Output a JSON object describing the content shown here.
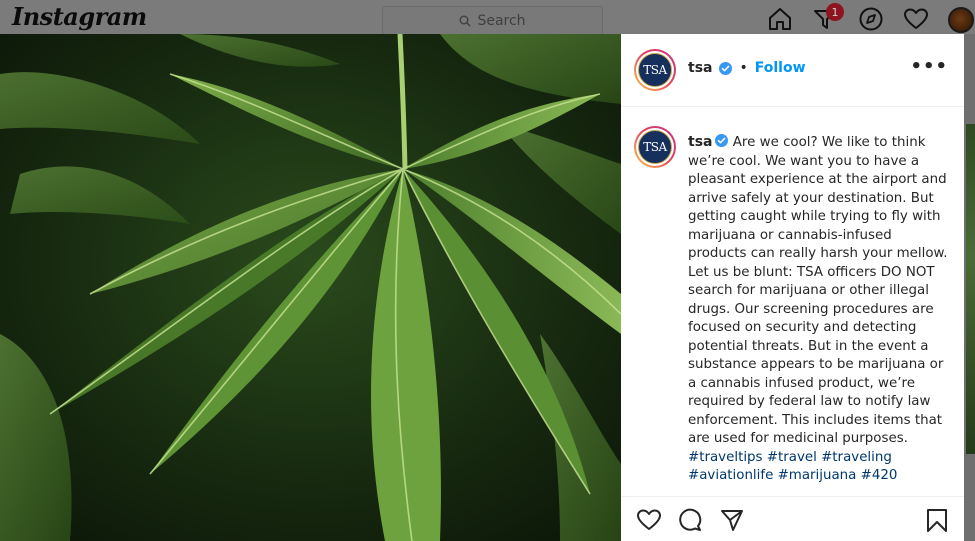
{
  "app": {
    "logo_text": "Instagram"
  },
  "search": {
    "placeholder": "Search",
    "icon": "search-icon"
  },
  "nav": {
    "icons": [
      "home-icon",
      "activity-icon",
      "explore-icon",
      "heart-icon",
      "profile-avatar"
    ],
    "activity_badge": "1"
  },
  "post": {
    "image": {
      "subject": "cannabis-leaf-photo"
    },
    "header": {
      "avatar_text": "TSA",
      "username": "tsa",
      "verified": true,
      "separator": "•",
      "follow_label": "Follow",
      "more_label": "•••"
    },
    "caption": {
      "username": "tsa",
      "lines": [
        "Are we cool? We like to think",
        "we’re cool. We want you to have a",
        "pleasant experience at the airport and",
        "arrive safely at your destination. But",
        "getting caught while trying to fly with",
        "marijuana or cannabis-infused",
        "products can really harsh your mellow.",
        "Let us be blunt: TSA officers DO NOT",
        "search for marijuana or other illegal",
        "drugs. Our screening procedures are",
        "focused on security and detecting",
        "potential threats. But in the event a",
        "substance appears to be marijuana or",
        "a cannabis infused product, we’re",
        "required by federal law to notify law",
        "enforcement. This includes items that",
        "are used for medicinal purposes."
      ],
      "hashtag_lines": [
        "#traveltips #travel #traveling",
        "#aviationlife #marijuana #420"
      ]
    },
    "actions": [
      "like-icon",
      "comment-icon",
      "share-icon",
      "save-icon"
    ]
  },
  "colors": {
    "accent_blue": "#0095f6",
    "hashtag": "#00376b",
    "text": "#262626",
    "badge": "#ed4956",
    "tsa_navy": "#15305c"
  }
}
